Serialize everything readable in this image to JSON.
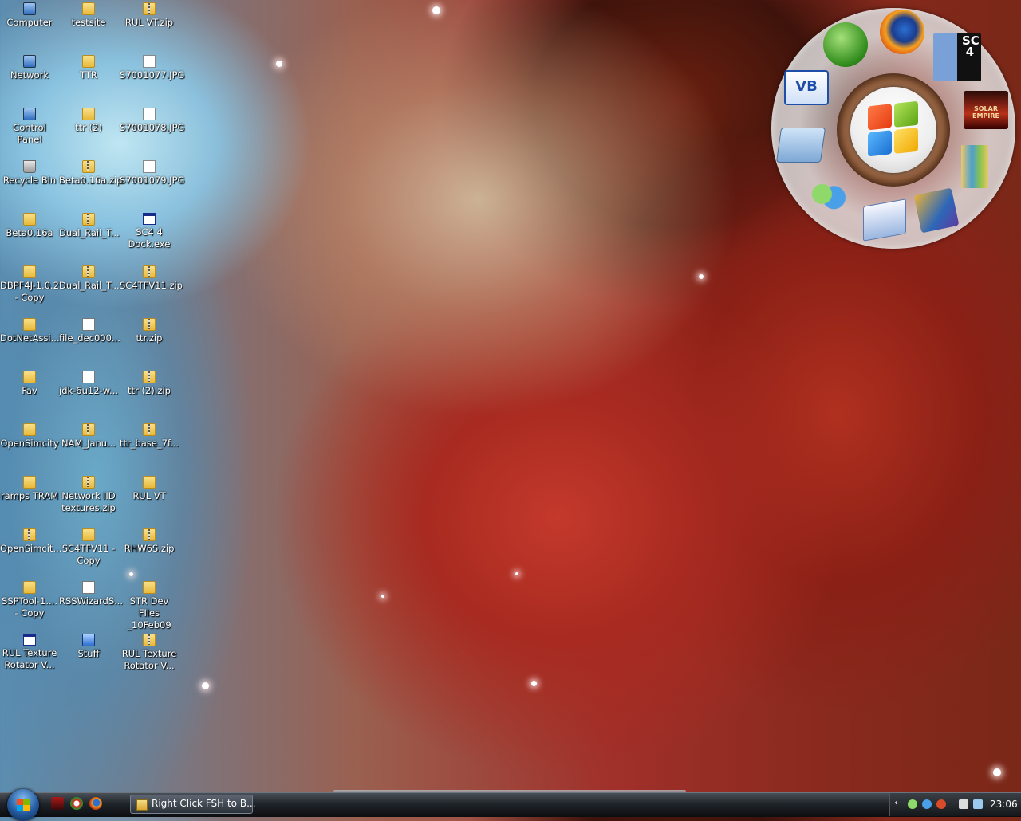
{
  "desktop": {
    "icons": [
      {
        "label": "Computer",
        "type": "sys"
      },
      {
        "label": "testsite",
        "type": "folder"
      },
      {
        "label": "RUL VT.zip",
        "type": "zip"
      },
      {
        "label": "Network",
        "type": "sys"
      },
      {
        "label": "TTR",
        "type": "folder"
      },
      {
        "label": "S7001077.JPG",
        "type": "jpg"
      },
      {
        "label": "Control\nPanel",
        "type": "sys"
      },
      {
        "label": "ttr (2)",
        "type": "folder"
      },
      {
        "label": "S7001078.JPG",
        "type": "jpg"
      },
      {
        "label": "Recycle Bin",
        "type": "bin"
      },
      {
        "label": "Beta0.16a.zip",
        "type": "zip"
      },
      {
        "label": "S7001079.JPG",
        "type": "jpg"
      },
      {
        "label": "Beta0.16a",
        "type": "folder"
      },
      {
        "label": "Dual_Rail_T...",
        "type": "zip"
      },
      {
        "label": "SC4 4\nDock.exe",
        "type": "exe"
      },
      {
        "label": "DBPF4J-1.0.2\n- Copy",
        "type": "folder"
      },
      {
        "label": "Dual_Rail_T...",
        "type": "zip"
      },
      {
        "label": "SC4TFV11.zip",
        "type": "zip"
      },
      {
        "label": "DotNetAssi...",
        "type": "folder"
      },
      {
        "label": "file_dec000...",
        "type": "doc"
      },
      {
        "label": "ttr.zip",
        "type": "zip"
      },
      {
        "label": "Fav",
        "type": "folder"
      },
      {
        "label": "jdk-6u12-w...",
        "type": "doc"
      },
      {
        "label": "ttr (2).zip",
        "type": "zip"
      },
      {
        "label": "OpenSimcity",
        "type": "folder"
      },
      {
        "label": "NAM_Janu...",
        "type": "zip"
      },
      {
        "label": "ttr_base_7f...",
        "type": "zip"
      },
      {
        "label": "ramps TRAM",
        "type": "folder"
      },
      {
        "label": "Network IID\ntextures.zip",
        "type": "zip"
      },
      {
        "label": "RUL VT",
        "type": "folder"
      },
      {
        "label": "OpenSimcit...",
        "type": "zip"
      },
      {
        "label": "SC4TFV11 -\nCopy",
        "type": "folder"
      },
      {
        "label": "RHW6S.zip",
        "type": "zip"
      },
      {
        "label": "SSPTool-1....\n- Copy",
        "type": "folder"
      },
      {
        "label": "RSSWizardS...",
        "type": "doc"
      },
      {
        "label": "STR Dev FIles\n_10Feb09",
        "type": "folder"
      },
      {
        "label": "RUL Texture\nRotator V...",
        "type": "exe"
      },
      {
        "label": "Stuff",
        "type": "stuff"
      },
      {
        "label": "RUL Texture\nRotator V...",
        "type": "zip"
      }
    ]
  },
  "dock": {
    "center_icon": "windows-logo-icon",
    "items": [
      "windows-start-icon",
      "firefox-icon",
      "simcity4-icon",
      "visual-basic-icon",
      "solar-empire-icon",
      "folder-icon",
      "books-icon",
      "messenger-icon",
      "mail-icon",
      "movie-maker-icon"
    ],
    "sc4_text": "SC\n4",
    "vb_text": "VB",
    "solar_text": "SOLAR EMPIRE"
  },
  "taskbar": {
    "active_window": "Right Click FSH to B...",
    "clock": "23:06",
    "tray_chevron": "‹"
  },
  "colors": {
    "taskbar": "#1f2429",
    "icon_label": "#ffffff"
  }
}
